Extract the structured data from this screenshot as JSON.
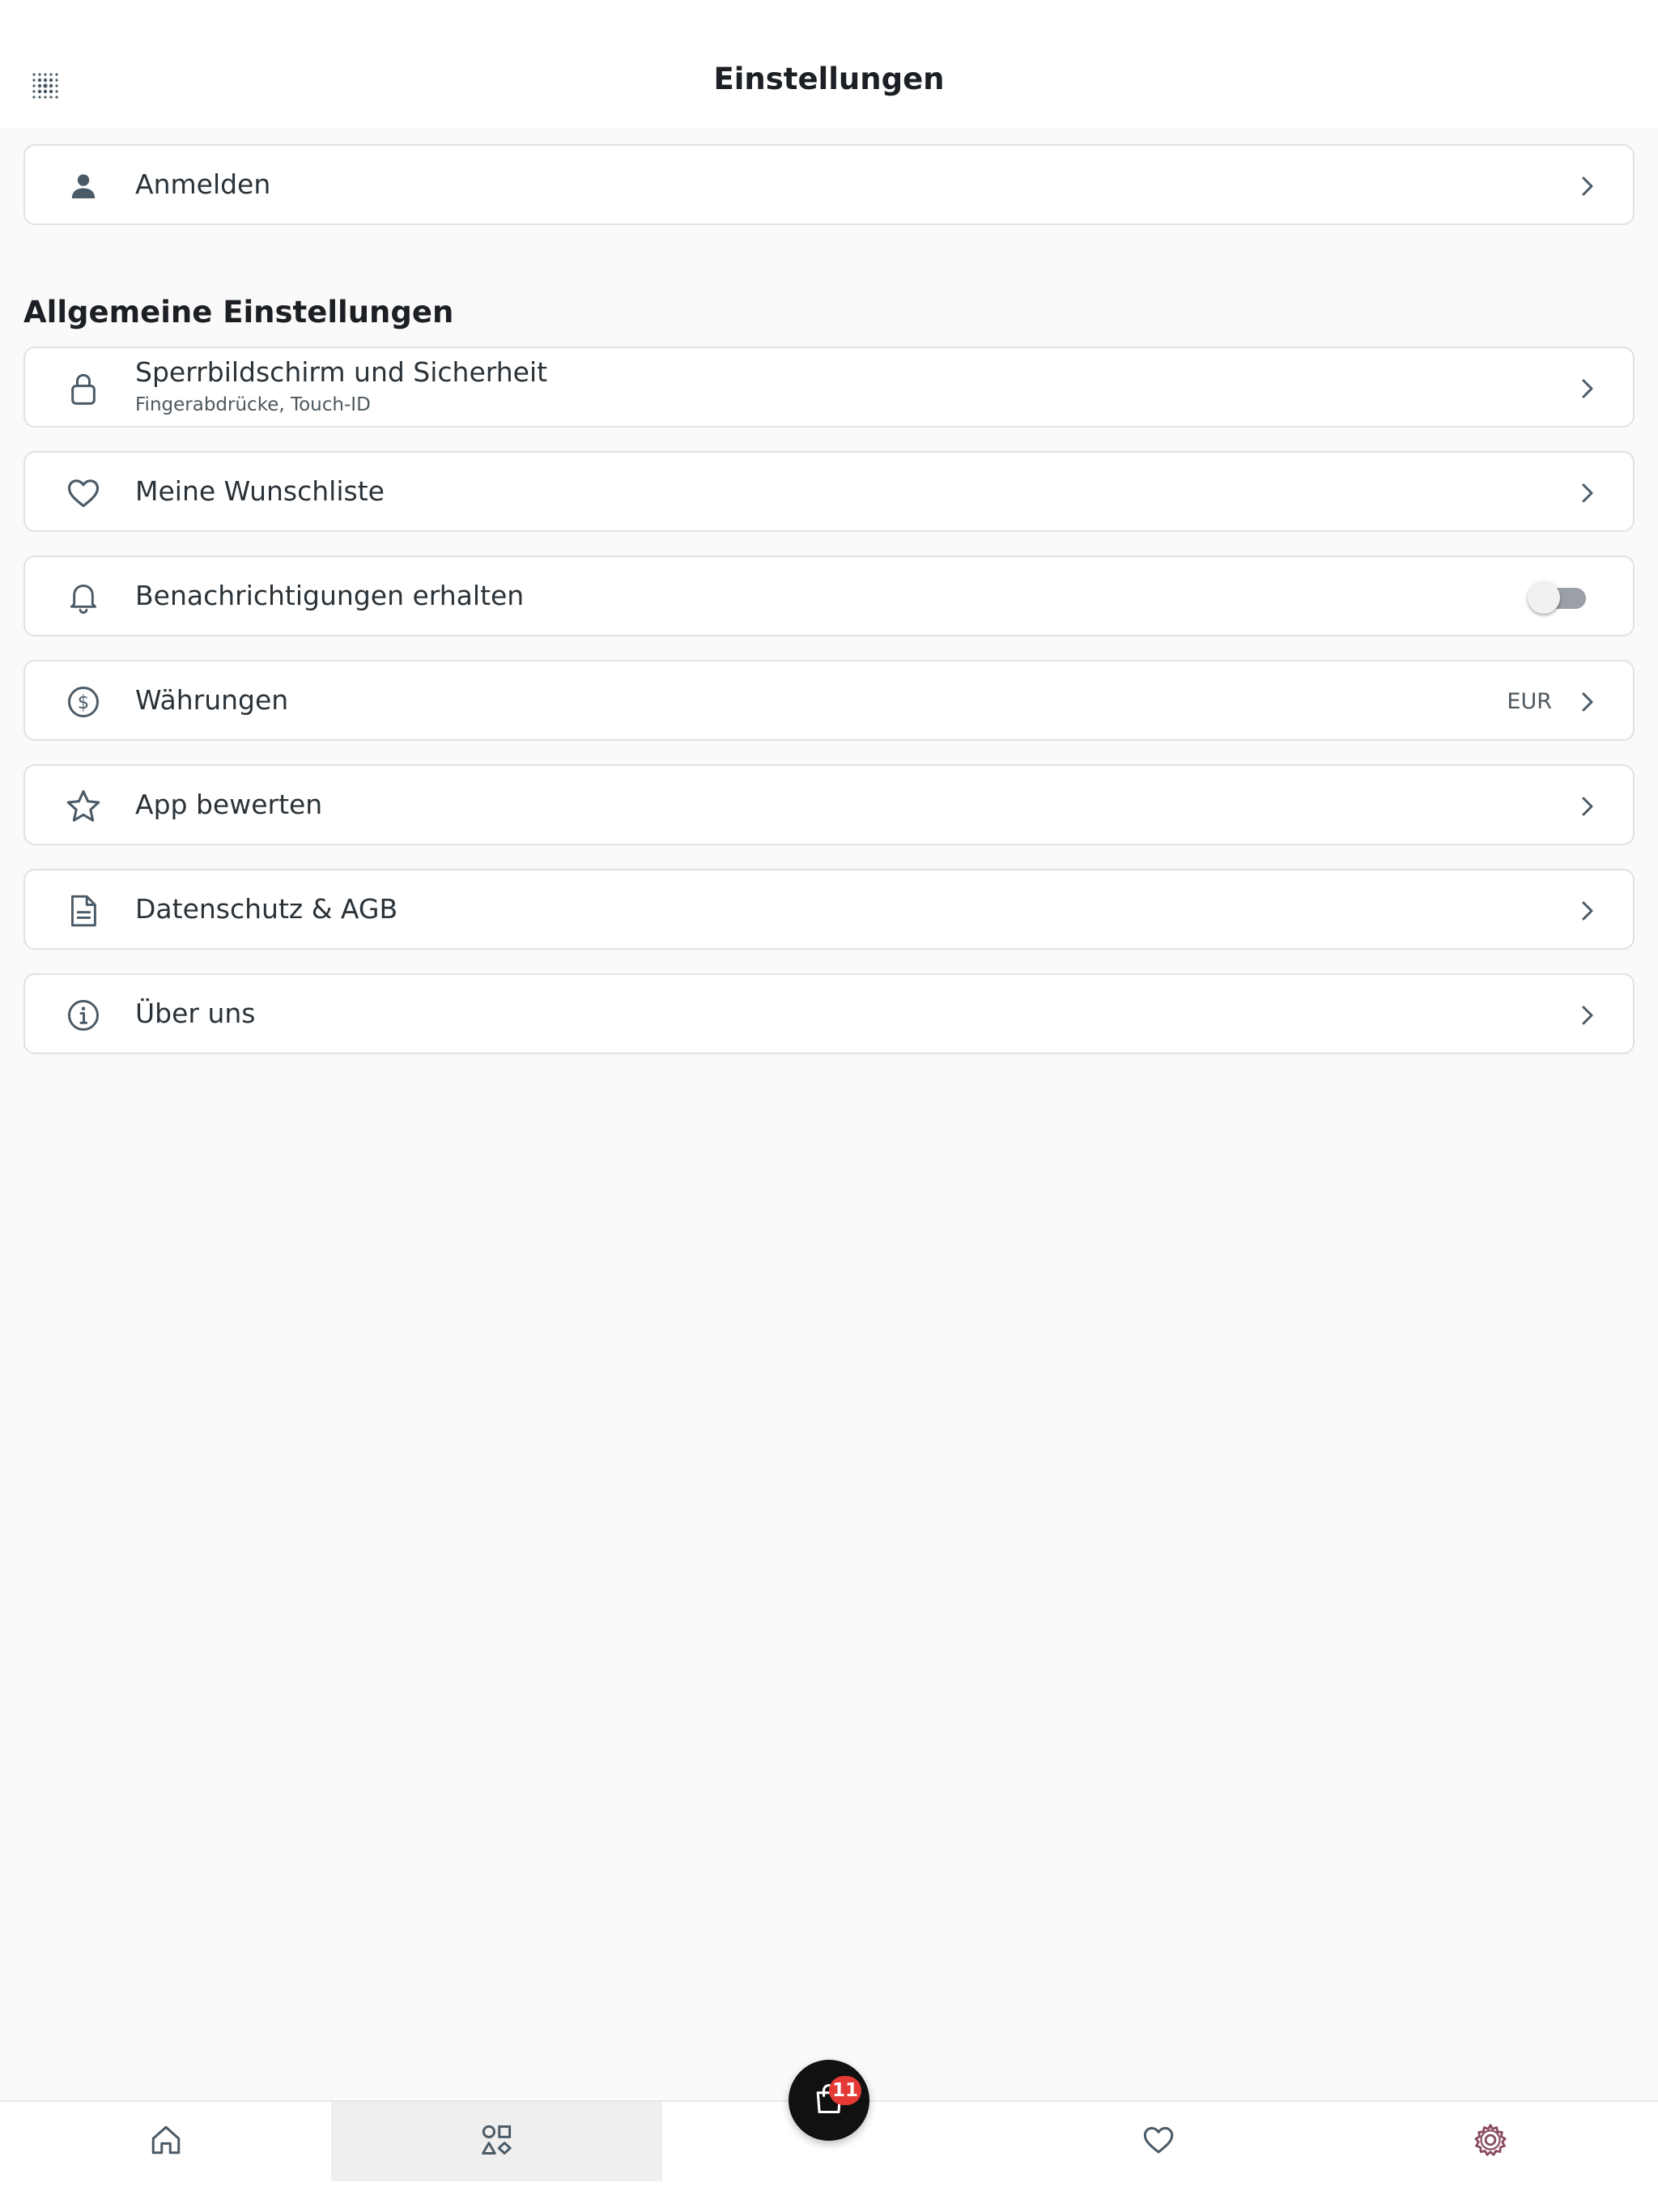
{
  "header": {
    "title": "Einstellungen",
    "menu_icon": "grid-dots-icon"
  },
  "login": {
    "label": "Anmelden",
    "icon": "user-icon"
  },
  "general": {
    "title": "Allgemeine Einstellungen",
    "items": [
      {
        "label": "Sperrbildschirm und Sicherheit",
        "sub": "Fingerabdrücke, Touch-ID",
        "icon": "lock-icon"
      },
      {
        "label": "Meine Wunschliste",
        "icon": "heart-icon"
      },
      {
        "label": "Benachrichtigungen erhalten",
        "icon": "bell-icon",
        "toggle_on": false
      },
      {
        "label": "Währungen",
        "value": "EUR",
        "icon": "dollar-circle-icon"
      },
      {
        "label": "App bewerten",
        "icon": "star-icon"
      },
      {
        "label": "Datenschutz & AGB",
        "icon": "document-icon"
      },
      {
        "label": "Über uns",
        "icon": "info-icon"
      }
    ]
  },
  "bottom_nav": {
    "items": [
      "home-icon",
      "categories-icon",
      "cart-icon",
      "heart-icon",
      "gear-icon"
    ],
    "active": "categories-icon",
    "cart_badge": "11"
  },
  "colors": {
    "icon": "#4a5a66",
    "badge": "#e53935",
    "fab": "#111111",
    "gear": "#8a4a5c"
  }
}
